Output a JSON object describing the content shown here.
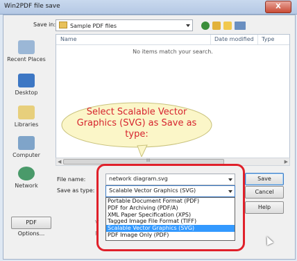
{
  "window": {
    "title": "Win2PDF file save",
    "close_glyph": "X"
  },
  "toolbar": {
    "save_in_label": "Save in:",
    "folder": "Sample PDF files"
  },
  "places": [
    {
      "label": "Recent Places",
      "icon": "recent-places-icon"
    },
    {
      "label": "Desktop",
      "icon": "desktop-icon"
    },
    {
      "label": "Libraries",
      "icon": "libraries-icon"
    },
    {
      "label": "Computer",
      "icon": "computer-icon"
    },
    {
      "label": "Network",
      "icon": "network-icon"
    }
  ],
  "list": {
    "columns": [
      "Name",
      "Date modified",
      "Type"
    ],
    "empty_message": "No items match your search.",
    "scroll_mark": "III"
  },
  "form": {
    "file_name_label": "File name:",
    "file_name_value": "network diagram.svg",
    "save_type_label": "Save as type:",
    "save_type_value": "Scalable Vector Graphics (SVG)"
  },
  "dropdown_options": [
    "Portable Document Format (PDF)",
    "PDF for Archiving (PDF/A)",
    "XML Paper Specification (XPS)",
    "Tagged Image File Format (TIFF)",
    "Scalable Vector Graphics (SVG)",
    "PDF Image Only (PDF)"
  ],
  "selected_option_index": 4,
  "buttons": {
    "save": "Save",
    "cancel": "Cancel",
    "help": "Help",
    "pdf_options": "PDF Options..."
  },
  "callout": {
    "text": "Select Scalable Vector Graphics (SVG) as Save as type:"
  },
  "colors": {
    "accent": "#3399ff",
    "highlight": "#e0202a",
    "callout_fill": "#fbf6c8"
  }
}
